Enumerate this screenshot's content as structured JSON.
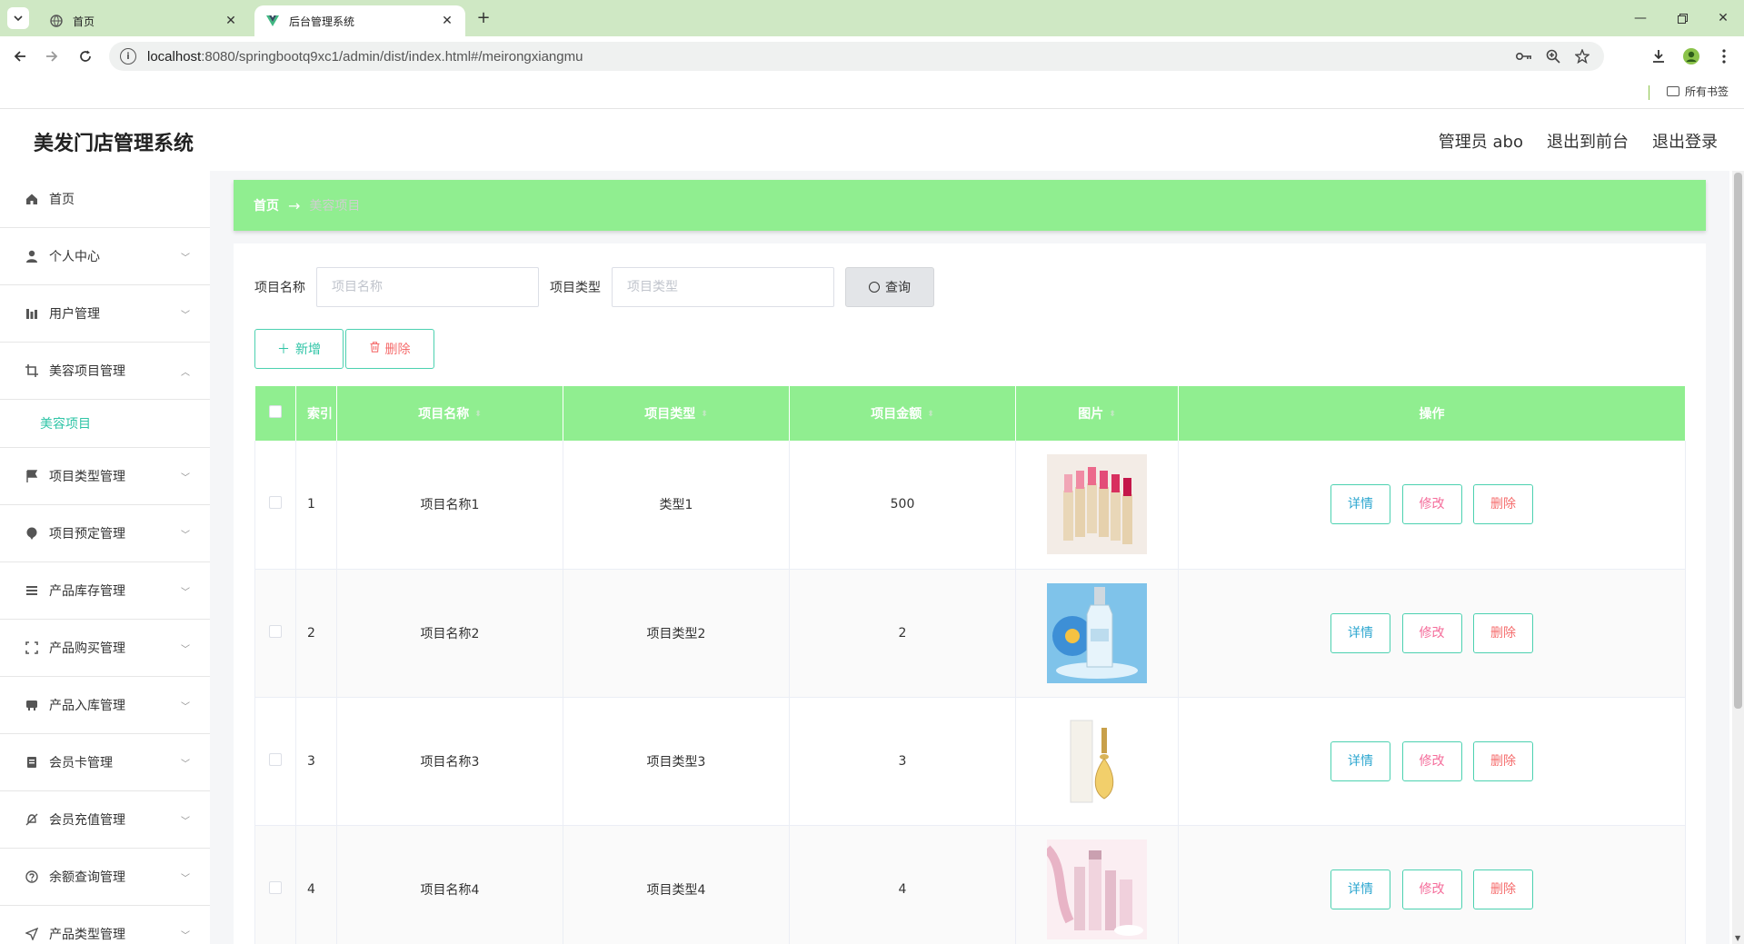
{
  "browser": {
    "tabs": [
      {
        "title": "首页",
        "active": false
      },
      {
        "title": "后台管理系统",
        "active": true
      }
    ],
    "url_host": "localhost",
    "url_path": ":8080/springbootq9xc1/admin/dist/index.html#/meirongxiangmu",
    "bookmarks_label": "所有书签"
  },
  "header": {
    "app_title": "美发门店管理系统",
    "user_label": "管理员 abo",
    "to_front_label": "退出到前台",
    "logout_label": "退出登录"
  },
  "sidebar": {
    "items": [
      {
        "label": "首页",
        "icon": "home-icon"
      },
      {
        "label": "个人中心",
        "icon": "user-icon"
      },
      {
        "label": "用户管理",
        "icon": "chart-icon"
      },
      {
        "label": "美容项目管理",
        "icon": "crop-icon",
        "expanded": true
      },
      {
        "label": "项目类型管理",
        "icon": "flag-icon"
      },
      {
        "label": "项目预定管理",
        "icon": "pin-icon"
      },
      {
        "label": "产品库存管理",
        "icon": "list-icon"
      },
      {
        "label": "产品购买管理",
        "icon": "frame-icon"
      },
      {
        "label": "产品入库管理",
        "icon": "box-icon"
      },
      {
        "label": "会员卡管理",
        "icon": "card-icon"
      },
      {
        "label": "会员充值管理",
        "icon": "bell-off-icon"
      },
      {
        "label": "余额查询管理",
        "icon": "question-icon"
      },
      {
        "label": "产品类型管理",
        "icon": "send-icon"
      }
    ],
    "sub_item": "美容项目"
  },
  "breadcrumb": {
    "home": "首页",
    "arrow": "→",
    "current": "美容项目"
  },
  "search": {
    "name_label": "项目名称",
    "name_placeholder": "项目名称",
    "type_label": "项目类型",
    "type_placeholder": "项目类型",
    "query_label": "查询"
  },
  "actions": {
    "add_label": "新增",
    "delete_label": "删除"
  },
  "table": {
    "headers": {
      "index": "索引",
      "name": "项目名称",
      "type": "项目类型",
      "amount": "项目金额",
      "image": "图片",
      "operation": "操作"
    },
    "rows": [
      {
        "index": "1",
        "name": "项目名称1",
        "type": "类型1",
        "amount": "500",
        "image": "lipstick-image"
      },
      {
        "index": "2",
        "name": "项目名称2",
        "type": "项目类型2",
        "amount": "2",
        "image": "serum-bottle-image"
      },
      {
        "index": "3",
        "name": "项目名称3",
        "type": "项目类型3",
        "amount": "3",
        "image": "perfume-image"
      },
      {
        "index": "4",
        "name": "项目名称4",
        "type": "项目类型4",
        "amount": "4",
        "image": "cosmetics-set-image"
      }
    ],
    "row_buttons": {
      "detail": "详情",
      "edit": "修改",
      "delete": "删除"
    }
  },
  "colors": {
    "accent_green": "#90ee90",
    "teal": "#2ec4a6",
    "danger": "#f56c6c",
    "tab_bar": "#cfe8c4"
  }
}
